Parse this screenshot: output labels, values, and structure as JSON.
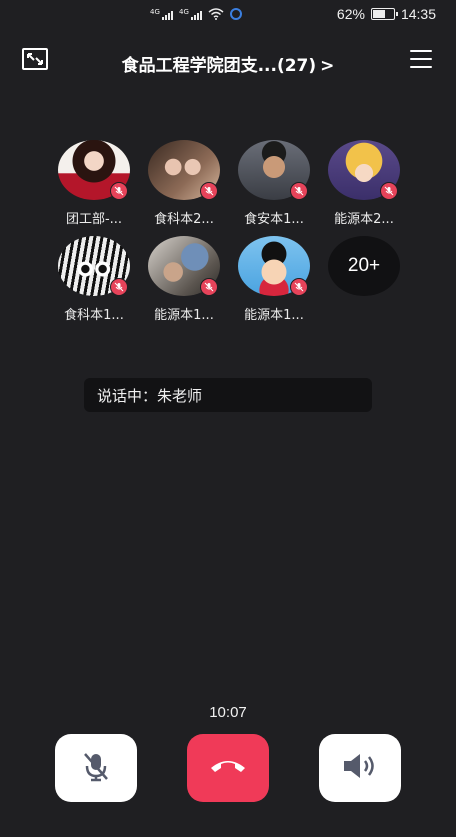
{
  "status_bar": {
    "signal_tag_1": "4G",
    "signal_tag_2": "4G",
    "battery_percent": "62%",
    "battery_level": 0.62,
    "time": "14:35"
  },
  "header": {
    "title": "食品工程学院团支...(27)",
    "chevron": ">"
  },
  "members": [
    {
      "name": "团工部-...",
      "avatar": "female-red-sweater-photo",
      "muted": true
    },
    {
      "name": "食科本2...",
      "avatar": "group-selfie-photo",
      "muted": true
    },
    {
      "name": "食安本1...",
      "avatar": "male-glasses-photo",
      "muted": true
    },
    {
      "name": "能源本2...",
      "avatar": "cartoon-blonde-girl",
      "muted": true
    },
    {
      "name": "食科本1...",
      "avatar": "manga-girl-drawing",
      "muted": true
    },
    {
      "name": "能源本1...",
      "avatar": "person-with-cat-photo",
      "muted": true
    },
    {
      "name": "能源本1...",
      "avatar": "crayon-shinchan-cartoon",
      "muted": true
    }
  ],
  "more_count": "20+",
  "speaking_banner": "说话中：朱老师",
  "call_duration": "10:07",
  "controls": {
    "mic_icon": "mic-muted-icon",
    "hangup_icon": "phone-hangup-icon",
    "speaker_icon": "speaker-icon"
  },
  "colors": {
    "background": "#1f1f22",
    "hangup": "#f03a58",
    "mute_badge": "#e6435a"
  }
}
